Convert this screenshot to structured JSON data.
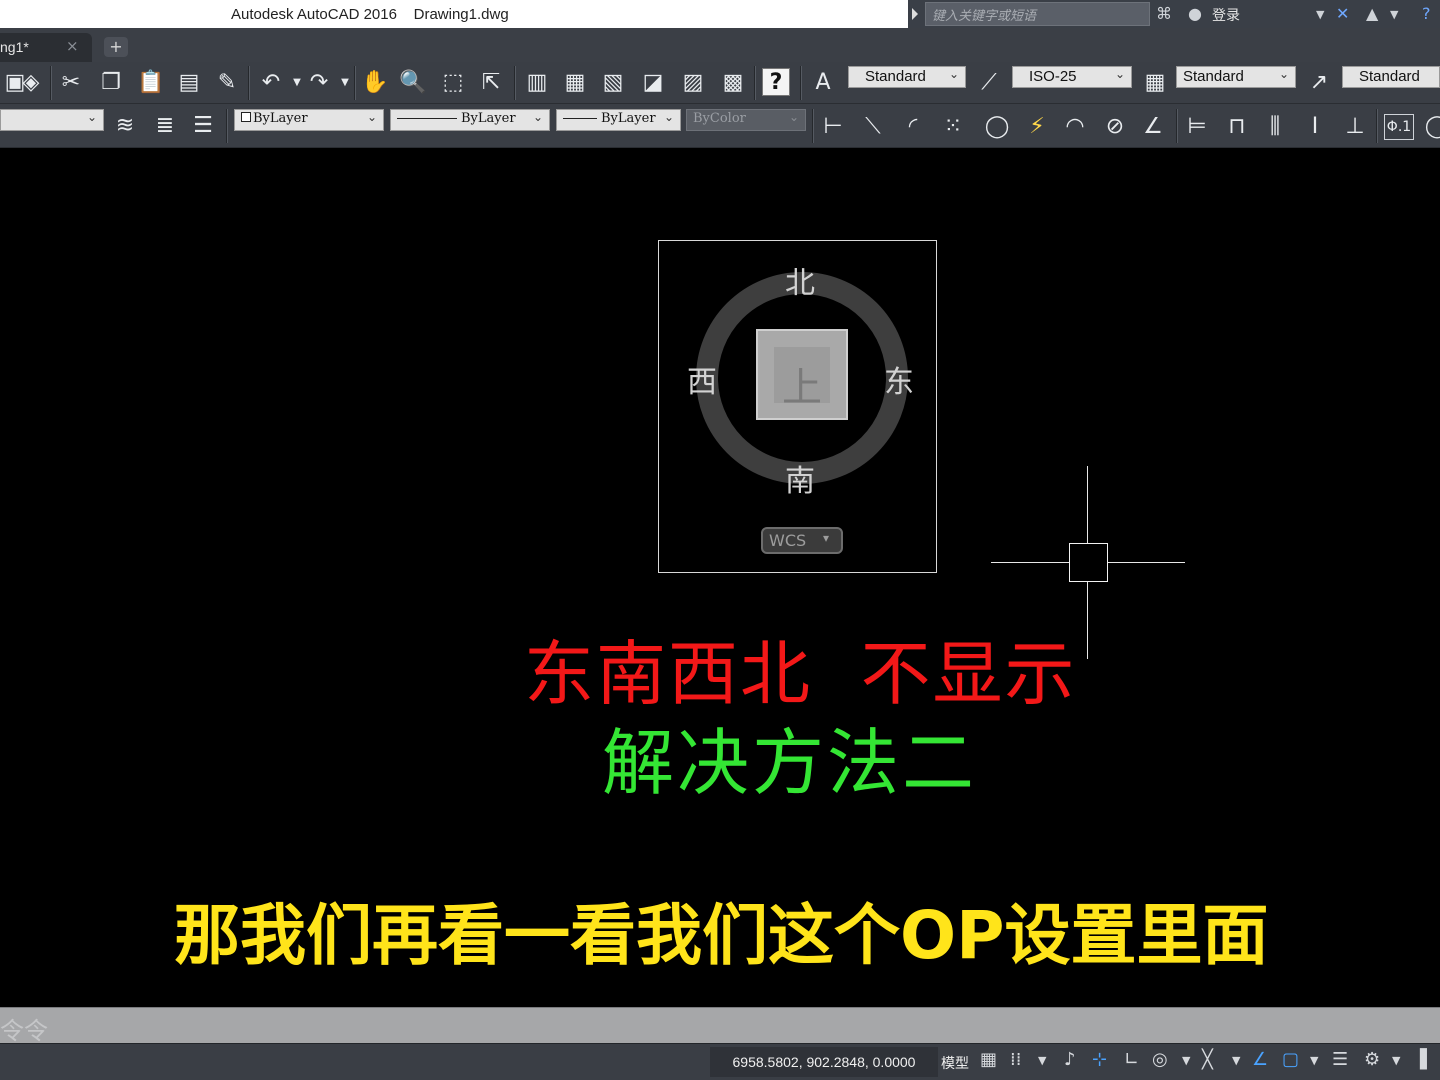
{
  "titlebar": {
    "app_title": "Autodesk AutoCAD 2016    Drawing1.dwg",
    "search_placeholder": "键入关键字或短语",
    "login_label": "登录"
  },
  "tabs": {
    "document_tab": "ng1*",
    "close_glyph": "×",
    "new_tab_glyph": "+"
  },
  "toolbar1": {
    "text_style": "Standard",
    "dim_style": "ISO-25",
    "table_style": "Standard",
    "multileader_style": "Standard",
    "help_glyph": "?"
  },
  "toolbar2": {
    "color": "ByLayer",
    "linetype": "ByLayer",
    "lineweight": "ByLayer",
    "plotstyle": "ByColor",
    "tolerance_glyph": "Φ.1"
  },
  "viewcube": {
    "north": "北",
    "south": "南",
    "east": "东",
    "west": "西",
    "face": "上",
    "ucs": "WCS"
  },
  "captions": {
    "red": "东南西北  不显示",
    "green": "解决方法二",
    "subtitle": "那我们再看一看我们这个OP设置里面"
  },
  "command_line": {
    "prompt": "令令"
  },
  "statusbar": {
    "coordinates": "6958.5802, 902.2848, 0.0000",
    "model": "模型"
  },
  "colors": {
    "caption_red": "#f31818",
    "caption_green": "#34e634",
    "subtitle_yellow": "#ffe41a",
    "ui_dark": "#3a3e45",
    "canvas": "#000000"
  }
}
